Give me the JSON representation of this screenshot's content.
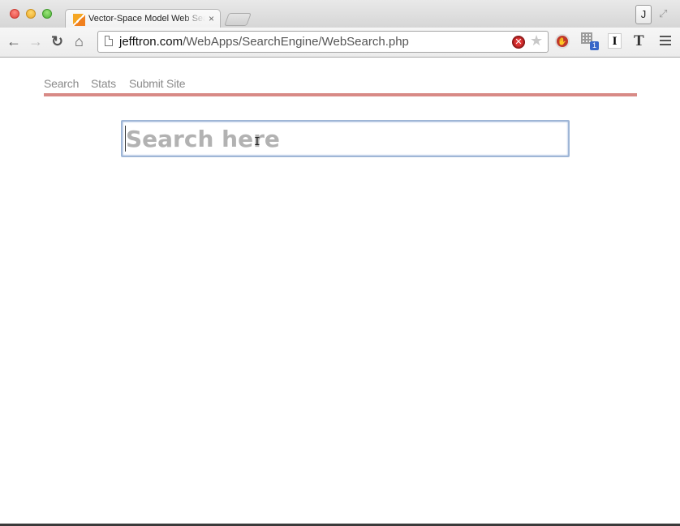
{
  "browser": {
    "tab": {
      "title": "Vector-Space Model Web Search",
      "close_glyph": "×"
    },
    "user_button": "J",
    "address_bar": {
      "host": "jefftron.com",
      "path": "/WebApps/SearchEngine/WebSearch.php"
    },
    "toolbar_icons": {
      "back": "back-arrow-icon",
      "forward": "forward-arrow-icon",
      "reload": "reload-icon",
      "home": "home-icon",
      "bookmark": "star-icon",
      "menu": "hamburger-menu-icon"
    },
    "extensions": {
      "tree_badge": "1",
      "i_label": "I",
      "t_label": "T"
    }
  },
  "page": {
    "nav": {
      "items": [
        {
          "label": "Search"
        },
        {
          "label": "Stats"
        },
        {
          "label": "Submit Site"
        }
      ],
      "rule_color": "#d88a86"
    },
    "search": {
      "placeholder": "Search here",
      "value": ""
    }
  }
}
